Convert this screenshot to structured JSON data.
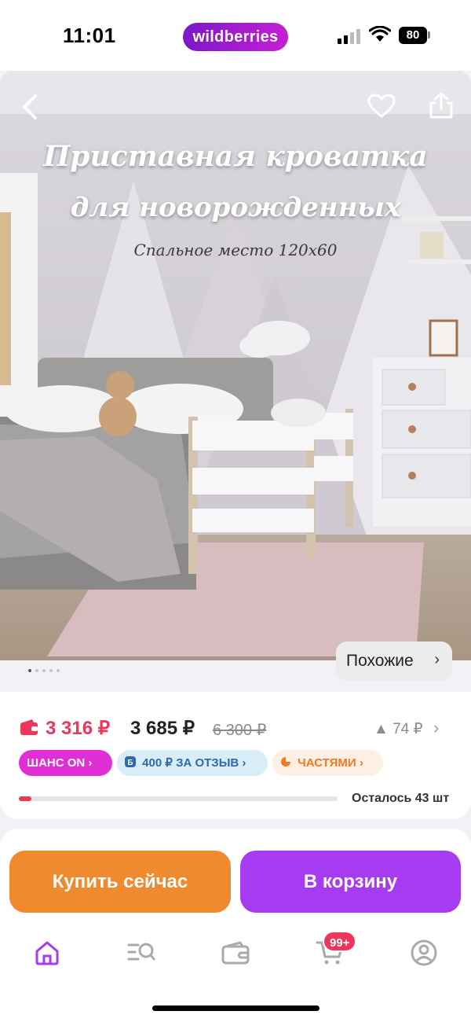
{
  "status_bar": {
    "time": "11:01",
    "app_badge": "wildberries",
    "battery": "80"
  },
  "hero": {
    "title_line1": "Приставная кроватка",
    "title_line2": "для новорожденных",
    "subtitle": "Спальное место 120х60",
    "similar_label": "Похожие",
    "slides_total": 5,
    "slide_active": 1
  },
  "price": {
    "wallet_price": "3 316 ₽",
    "price": "3 685 ₽",
    "old_price": "6 300 ₽",
    "delta": "▲ 74 ₽"
  },
  "badges": {
    "chance": "ШАНС ON",
    "review": "400 ₽ ЗА ОТЗЫВ",
    "parts": "ЧАСТЯМИ"
  },
  "stock": {
    "label": "Осталось 43 шт",
    "fill_fraction": 0.04
  },
  "actions": {
    "buy_now": "Купить сейчас",
    "add_to_cart": "В корзину"
  },
  "tabbar": {
    "cart_count": "99+"
  },
  "colors": {
    "accent_purple": "#a63bf1",
    "accent_orange": "#f08a2e",
    "price_red": "#f0355b",
    "chance_pink": "#e12fd6"
  },
  "icons": [
    "back-icon",
    "heart-icon",
    "share-icon",
    "wallet-icon",
    "chevron-right-icon",
    "home-icon",
    "search-catalog-icon",
    "wallet-tab-icon",
    "cart-icon",
    "profile-icon"
  ]
}
